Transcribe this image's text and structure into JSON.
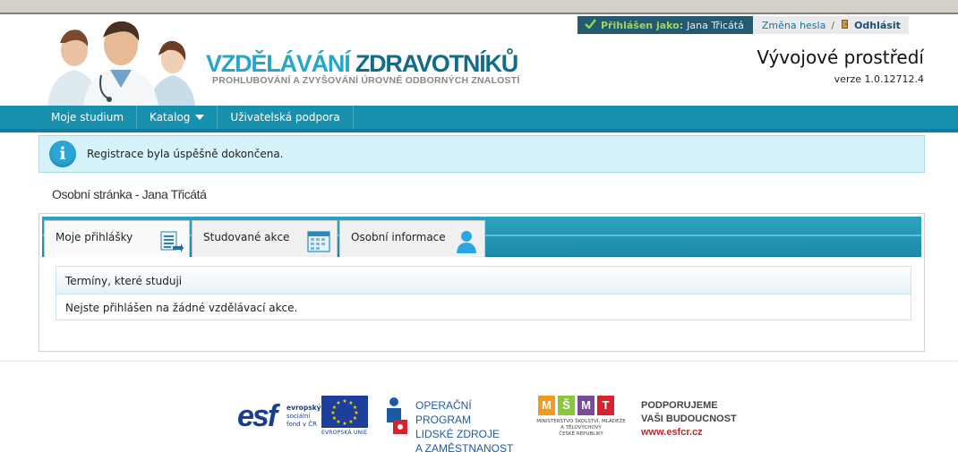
{
  "header": {
    "logo_title_a": "VZDĚLÁVÁNÍ ",
    "logo_title_b": "ZDRAVOTNÍKŮ",
    "logo_subtitle": "PROHLUBOVÁNÍ A ZVYŠOVÁNÍ ÚROVNĚ ODBORNÝCH ZNALOSTÍ",
    "environment": "Vývojové prostředí",
    "version": "verze 1.0.12712.4"
  },
  "userbar": {
    "logged_label": "Přihlášen jako:",
    "user_name": "Jana Třicátá",
    "change_password": "Změna hesla",
    "separator": "/",
    "logout": "Odhlásit"
  },
  "nav": {
    "items": [
      {
        "label": "Moje studium"
      },
      {
        "label": "Katalog"
      },
      {
        "label": "Uživatelská podpora"
      }
    ]
  },
  "message": {
    "icon": "info-icon",
    "text": "Registrace byla úspěšně dokončena."
  },
  "page_title": "Osobní stránka - Jana Třicátá",
  "tabs": [
    {
      "label": "Moje přihlášky",
      "icon": "document-list-icon"
    },
    {
      "label": "Studované akce",
      "icon": "calendar-icon"
    },
    {
      "label": "Osobní informace",
      "icon": "person-icon"
    }
  ],
  "terms_box": {
    "title": "Termíny, které studuji",
    "empty_text": "Nejste přihlášen na žádné vzdělávací akce."
  },
  "footer": {
    "esf_logo": "esf",
    "esf_line1": "evropský",
    "esf_line2": "sociální",
    "esf_line3": "fond v ČR",
    "eu_caption": "EVROPSKÁ UNIE",
    "op_line1": "OPERAČNÍ PROGRAM",
    "op_line2": "LIDSKÉ ZDROJE",
    "op_line3": "A ZAMĚSTNANOST",
    "msmt_blocks": [
      "M",
      "Š",
      "M",
      "T"
    ],
    "msmt_line1": "MINISTERSTVO ŠKOLSTVÍ, MLÁDEŽE A TĚLOVÝCHOVY",
    "msmt_line2": "ČESKÉ REPUBLIKY",
    "slogan1": "PODPORUJEME",
    "slogan2": "VAŠI BUDOUCNOST",
    "url": "www.esfcr.cz"
  },
  "colors": {
    "nav_teal": "#1791ad",
    "info_bg": "#d7f3fa",
    "user_dark": "#245a70",
    "brand_light": "#27a6c9",
    "brand_dark": "#0f6d8a"
  }
}
